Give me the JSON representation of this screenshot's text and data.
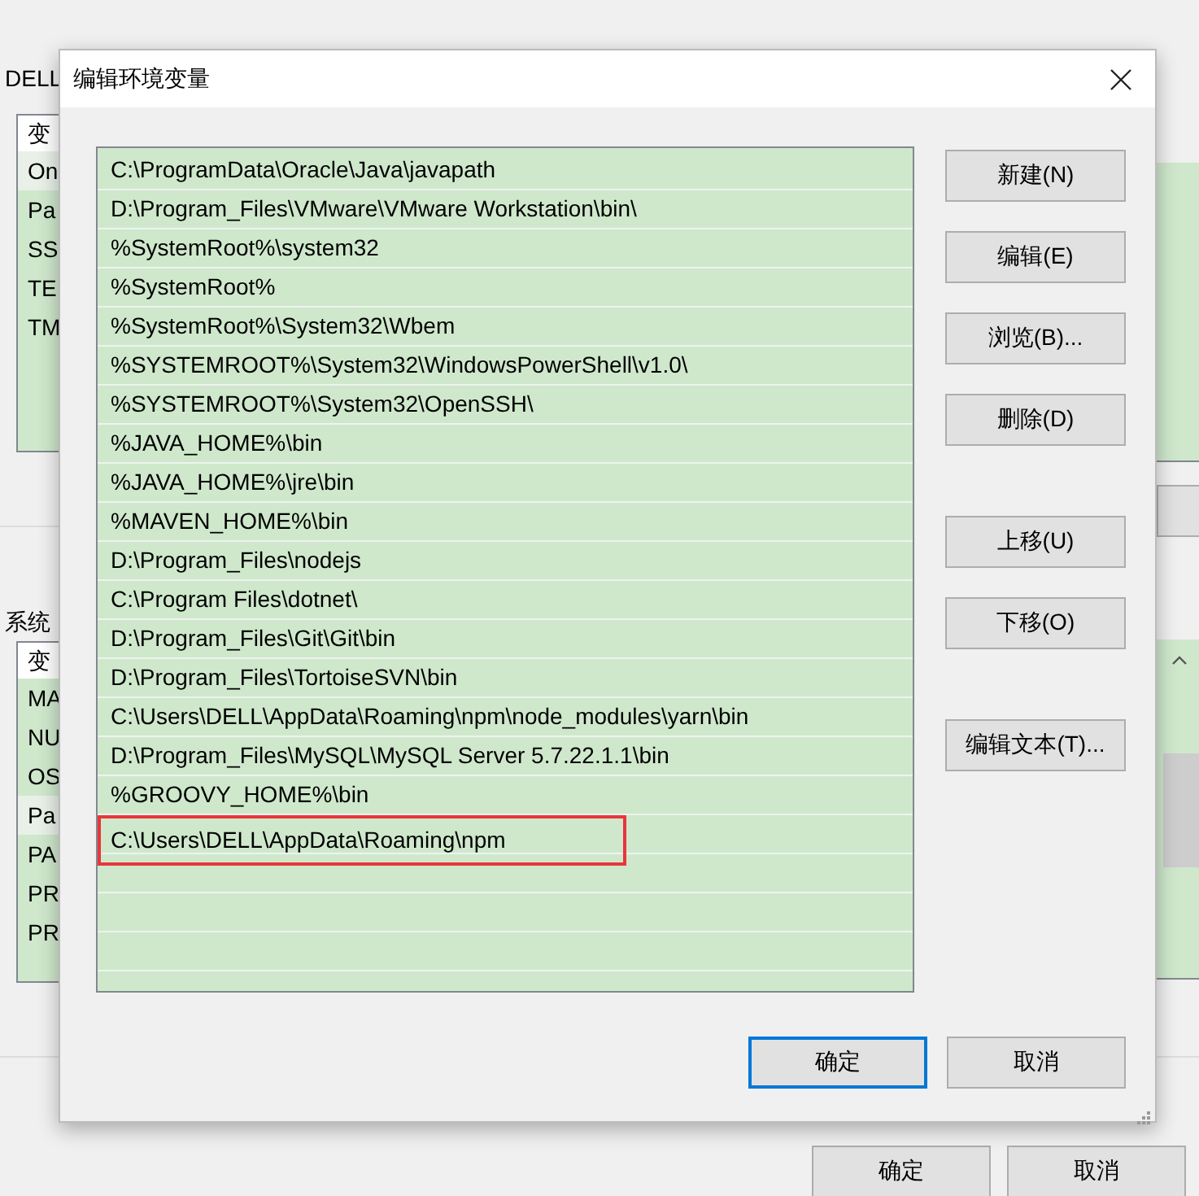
{
  "background_window": {
    "user_label": "DELL",
    "user_list": {
      "header": "变",
      "items": [
        {
          "text": "On",
          "selected": true
        },
        {
          "text": "Pa",
          "selected": false
        },
        {
          "text": "SS",
          "selected": false
        },
        {
          "text": "TE",
          "selected": false
        },
        {
          "text": "TM",
          "selected": false
        }
      ]
    },
    "system_label": "系统",
    "system_list": {
      "header": "变",
      "items": [
        {
          "text": "MA",
          "selected": false
        },
        {
          "text": "NU",
          "selected": false
        },
        {
          "text": "OS",
          "selected": false
        },
        {
          "text": "Pa",
          "selected": true
        },
        {
          "text": "PA",
          "selected": false
        },
        {
          "text": "PR",
          "selected": false
        },
        {
          "text": "PR",
          "selected": false
        }
      ]
    },
    "buttons": [
      "确定",
      "取消"
    ]
  },
  "dialog": {
    "title": "编辑环境变量",
    "paths": [
      {
        "text": "C:\\ProgramData\\Oracle\\Java\\javapath",
        "highlighted": false
      },
      {
        "text": "D:\\Program_Files\\VMware\\VMware Workstation\\bin\\",
        "highlighted": false
      },
      {
        "text": "%SystemRoot%\\system32",
        "highlighted": false
      },
      {
        "text": "%SystemRoot%",
        "highlighted": false
      },
      {
        "text": "%SystemRoot%\\System32\\Wbem",
        "highlighted": false
      },
      {
        "text": "%SYSTEMROOT%\\System32\\WindowsPowerShell\\v1.0\\",
        "highlighted": false
      },
      {
        "text": "%SYSTEMROOT%\\System32\\OpenSSH\\",
        "highlighted": false
      },
      {
        "text": "%JAVA_HOME%\\bin",
        "highlighted": false
      },
      {
        "text": "%JAVA_HOME%\\jre\\bin",
        "highlighted": false
      },
      {
        "text": "%MAVEN_HOME%\\bin",
        "highlighted": false
      },
      {
        "text": "D:\\Program_Files\\nodejs",
        "highlighted": false
      },
      {
        "text": "C:\\Program Files\\dotnet\\",
        "highlighted": false
      },
      {
        "text": "D:\\Program_Files\\Git\\Git\\bin",
        "highlighted": false
      },
      {
        "text": "D:\\Program_Files\\TortoiseSVN\\bin",
        "highlighted": false
      },
      {
        "text": "C:\\Users\\DELL\\AppData\\Roaming\\npm\\node_modules\\yarn\\bin",
        "highlighted": false
      },
      {
        "text": "D:\\Program_Files\\MySQL\\MySQL Server 5.7.22.1.1\\bin",
        "highlighted": false
      },
      {
        "text": "%GROOVY_HOME%\\bin",
        "highlighted": false
      },
      {
        "text": "C:\\Users\\DELL\\AppData\\Roaming\\npm",
        "highlighted": true
      }
    ],
    "side_buttons": [
      "新建(N)",
      "编辑(E)",
      "浏览(B)...",
      "删除(D)",
      "上移(U)",
      "下移(O)",
      "编辑文本(T)..."
    ],
    "ok_button": "确定",
    "cancel_button": "取消"
  }
}
